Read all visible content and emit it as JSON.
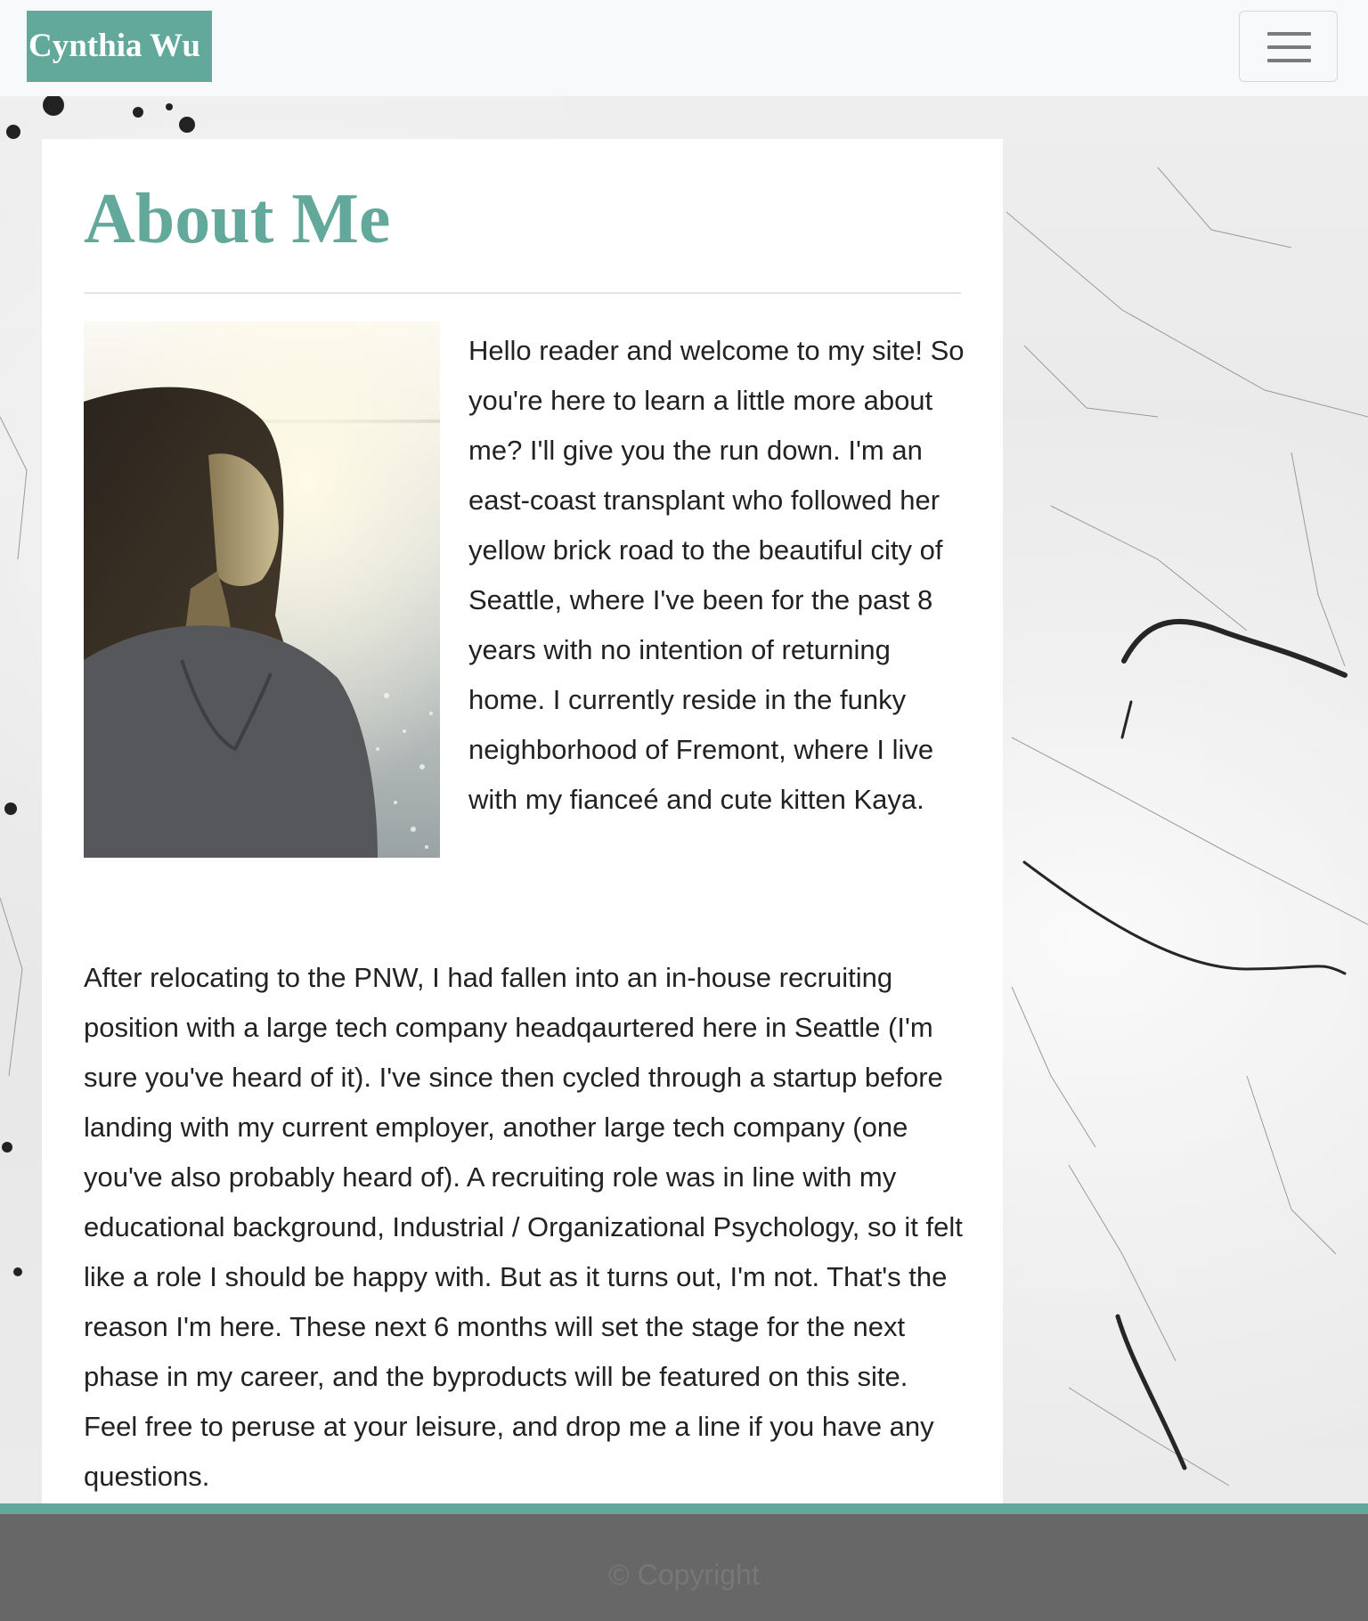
{
  "navbar": {
    "brand": "Cynthia Wu",
    "toggle_icon": "hamburger-menu-icon"
  },
  "about": {
    "title": "About Me",
    "paragraph_1": "Hello reader and welcome to my site! So you're here to learn a little more about me? I'll give you the run down. I'm an east-coast transplant who followed her yellow brick road to the beautiful city of Seattle, where I've been for the past 8 years with no intention of returning home. I currently reside in the funky neighborhood of Fremont, where I live with my fianceé and cute kitten Kaya.",
    "paragraph_2": "After relocating to the PNW, I had fallen into an in-house recruiting position with a large tech company headqaurtered here in Seattle (I'm sure you've heard of it). I've since then cycled through a startup before landing with my current employer, another large tech company (one you've also probably heard of). A recruiting role was in line with my educational background, Industrial / Organizational Psychology, so it felt like a role I should be happy with. But as it turns out, I'm not. That's the reason I'm here. These next 6 months will set the stage for the next phase in my career, and the byproducts will be featured on this site. Feel free to peruse at your leisure, and drop me a line if you have any questions."
  },
  "footer": {
    "copyright": "© Copyright"
  },
  "colors": {
    "accent": "#62a89b",
    "navbar_bg": "#f8f9fa",
    "footer_bg": "#676767",
    "text": "#222222"
  }
}
